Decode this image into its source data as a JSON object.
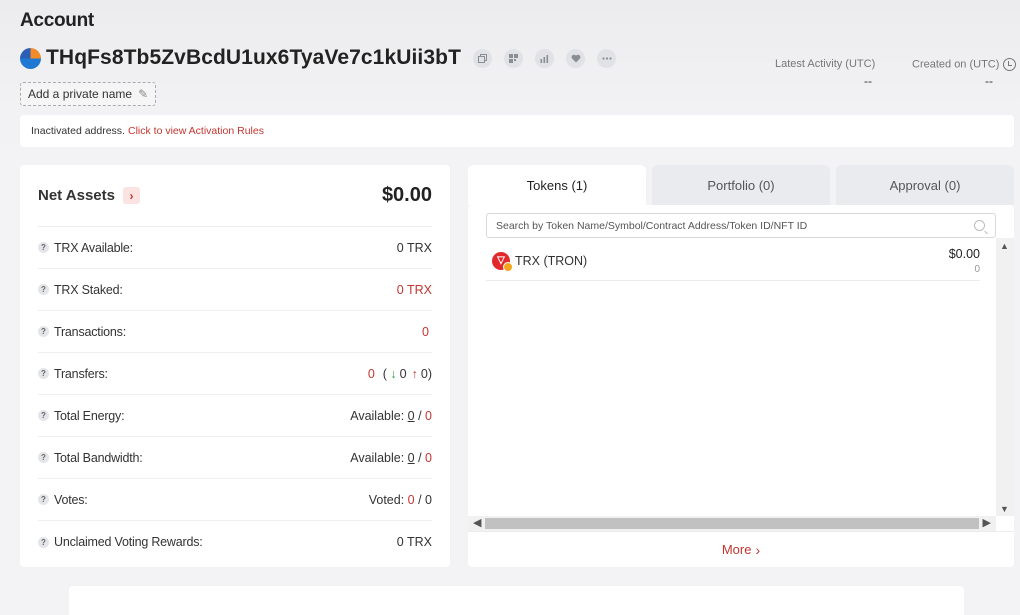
{
  "header": {
    "title": "Account",
    "address": "THqFs8Tb5ZvBcdU1ux6TyaVe7c1kUii3bT",
    "private_name_label": "Add a private name",
    "latest_activity_label": "Latest Activity (UTC)",
    "latest_activity_value": "--",
    "created_on_label": "Created on (UTC)",
    "created_on_value": "--"
  },
  "banner": {
    "text": "Inactivated address.",
    "link": "Click to view Activation Rules"
  },
  "net_assets": {
    "title": "Net Assets",
    "amount": "$0.00",
    "rows": [
      {
        "label": "TRX Available:",
        "value": "0 TRX"
      },
      {
        "label": "TRX Staked:",
        "value": "0 TRX"
      },
      {
        "label": "Transactions:",
        "value": "0"
      },
      {
        "label": "Transfers:",
        "total": "0",
        "in": "0",
        "out": "0"
      },
      {
        "label": "Total Energy:",
        "prefix": "Available:",
        "available": "0",
        "total": "0"
      },
      {
        "label": "Total Bandwidth:",
        "prefix": "Available:",
        "available": "0",
        "total": "0"
      },
      {
        "label": "Votes:",
        "prefix": "Voted:",
        "voted": "0",
        "total": "0"
      },
      {
        "label": "Unclaimed Voting Rewards:",
        "value": "0 TRX"
      }
    ]
  },
  "tabs": [
    {
      "label": "Tokens (1)"
    },
    {
      "label": "Portfolio (0)"
    },
    {
      "label": "Approval (0)"
    }
  ],
  "tokens": {
    "search_placeholder": "Search by Token Name/Symbol/Contract Address/Token ID/NFT ID",
    "items": [
      {
        "name": "TRX (TRON)",
        "usd": "$0.00",
        "amount": "0"
      }
    ],
    "more_label": "More"
  },
  "colors": {
    "accent": "#c23631",
    "green": "#2fa24a",
    "background": "#f3f3f5"
  }
}
